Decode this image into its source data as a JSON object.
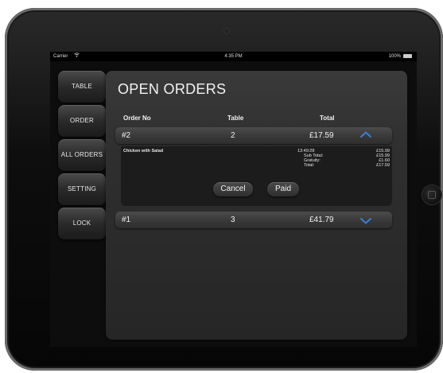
{
  "status_bar": {
    "carrier": "Carrier",
    "time": "4:35 PM",
    "battery": "100%",
    "battery_level": 1.0
  },
  "sidebar": {
    "items": [
      {
        "label": "TABLE"
      },
      {
        "label": "ORDER"
      },
      {
        "label": "ALL ORDERS"
      },
      {
        "label": "SETTING"
      },
      {
        "label": "LOCK"
      }
    ]
  },
  "main": {
    "title": "OPEN ORDERS",
    "columns": {
      "order_no": "Order No",
      "table": "Table",
      "total": "Total"
    },
    "orders": [
      {
        "order_no": "#2",
        "table": "2",
        "total": "£17.59",
        "expanded": true,
        "item": {
          "name": "Chicken with Salad",
          "time": "13:49:28",
          "price": "£15.99"
        },
        "summary": [
          {
            "label": "Sub Total:",
            "value": "£15.99"
          },
          {
            "label": "Gratuity:",
            "value": "£1.60"
          },
          {
            "label": "Total:",
            "value": "£17.59"
          }
        ],
        "actions": {
          "cancel": "Cancel",
          "paid": "Paid"
        }
      },
      {
        "order_no": "#1",
        "table": "3",
        "total": "£41.79",
        "expanded": false
      }
    ]
  },
  "colors": {
    "accent": "#3a7fd5",
    "panel": "#2f2f2f",
    "text": "#f2f2f2"
  },
  "icons": {
    "expanded_chevron": "chevron-up-icon",
    "collapsed_chevron": "chevron-down-icon",
    "wifi": "wifi-icon",
    "battery": "battery-icon"
  }
}
